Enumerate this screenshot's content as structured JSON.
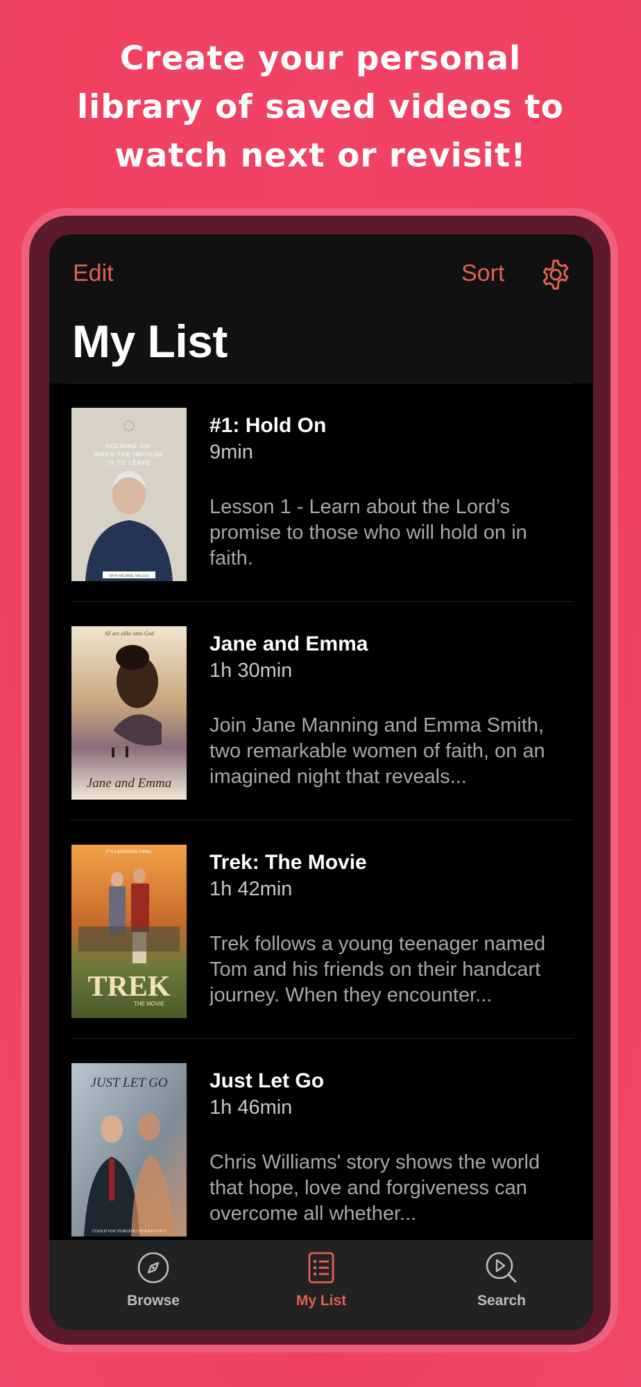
{
  "promo": {
    "line1": "Create your personal",
    "line2": "library of saved videos to",
    "line3": "watch next or revisit!"
  },
  "navbar": {
    "edit_label": "Edit",
    "sort_label": "Sort",
    "settings_icon": "gear-icon",
    "title": "My List"
  },
  "items": [
    {
      "title": "#1: Hold On",
      "duration": "9min",
      "description": "Lesson 1 - Learn about the Lord’s promise to those who will hold on in faith.",
      "poster_text": "HOLDING ON: WHEN THE IMPULSE IS TO LEAVE",
      "poster_caption": "WITH MICHAEL WILCOX"
    },
    {
      "title": "Jane and Emma",
      "duration": "1h 30min",
      "description": "Join Jane Manning and Emma Smith, two remarkable women of faith, on an imagined night that reveals...",
      "poster_text": "All are alike unto God",
      "poster_caption": "Jane and Emma"
    },
    {
      "title": "Trek: The Movie",
      "duration": "1h 42min",
      "description": "Trek follows a young teenager named Tom and his friends on their handcart journey. When they encounter...",
      "poster_text": "IT'S A MORMON THING.",
      "poster_caption": "TREK",
      "poster_sub": "THE MOVIE"
    },
    {
      "title": "Just Let Go",
      "duration": "1h 46min",
      "description": "Chris Williams' story shows the world that hope, love and forgiveness can overcome all whether...",
      "poster_text": "JUST LET GO",
      "poster_caption": "COULD YOU FORGIVE? WOULD YOU?"
    }
  ],
  "tabbar": {
    "tabs": [
      {
        "label": "Browse",
        "icon": "compass-icon",
        "active": false
      },
      {
        "label": "My List",
        "icon": "list-icon",
        "active": true
      },
      {
        "label": "Search",
        "icon": "search-play-icon",
        "active": false
      }
    ]
  },
  "colors": {
    "background": "#ef4060",
    "accent": "#e0624f",
    "screen": "#000000"
  }
}
